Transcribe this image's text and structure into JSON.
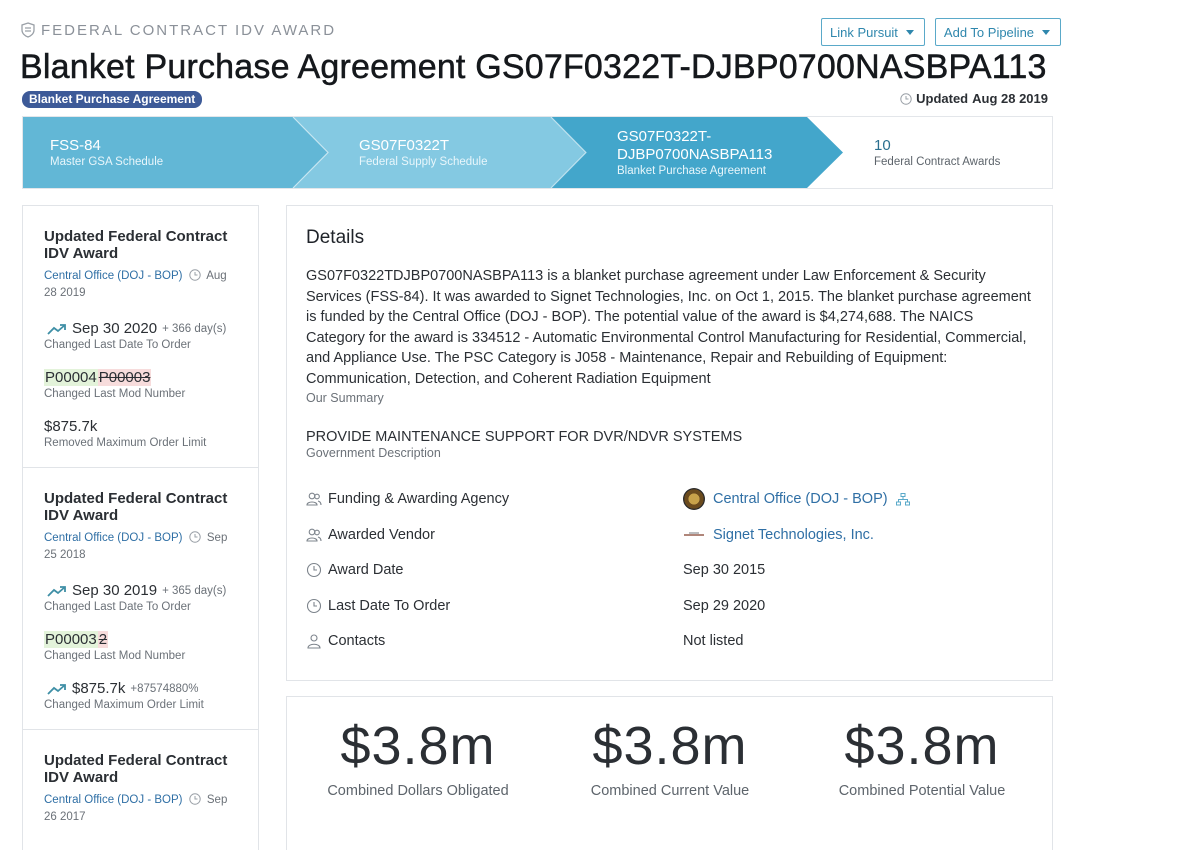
{
  "header": {
    "eyebrow": "FEDERAL CONTRACT IDV AWARD",
    "title": "Blanket Purchase Agreement GS07F0322T-DJBP0700NASBPA113",
    "type_badge": "Blanket Purchase Agreement",
    "updated_label": "Updated",
    "updated_date": "Aug 28 2019",
    "actions": [
      "Link Pursuit",
      "Add To Pipeline"
    ]
  },
  "breadcrumbs": [
    {
      "title": "FSS-84",
      "subtitle": "Master GSA Schedule"
    },
    {
      "title": "GS07F0322T",
      "subtitle": "Federal Supply Schedule"
    },
    {
      "title_line1": "GS07F0322T-",
      "title_line2": "DJBP0700NASBPA113",
      "subtitle": "Blanket Purchase Agreement"
    },
    {
      "title": "10",
      "subtitle": "Federal Contract Awards"
    }
  ],
  "timeline": [
    {
      "title": "Updated Federal Contract IDV Award",
      "agency": "Central Office (DOJ - BOP)",
      "date": "Aug 28 2019",
      "changes": [
        {
          "value": "Sep 30 2020",
          "delta": "+ 366 day(s)",
          "desc": "Changed Last Date To Order"
        },
        {
          "new": "P00004",
          "old": "P00003",
          "desc": "Changed Last Mod Number"
        },
        {
          "value": "$875.7k",
          "desc": "Removed Maximum Order Limit"
        }
      ]
    },
    {
      "title": "Updated Federal Contract IDV Award",
      "agency": "Central Office (DOJ - BOP)",
      "date": "Sep 25 2018",
      "changes": [
        {
          "value": "Sep 30 2019",
          "delta": "+ 365 day(s)",
          "desc": "Changed Last Date To Order"
        },
        {
          "new": "P00003",
          "old": "2",
          "desc": "Changed Last Mod Number"
        },
        {
          "value": "$875.7k",
          "delta": "+87574880%",
          "desc": "Changed Maximum Order Limit"
        }
      ]
    },
    {
      "title": "Updated Federal Contract IDV Award",
      "agency": "Central Office (DOJ - BOP)",
      "date": "Sep 26 2017"
    }
  ],
  "details": {
    "heading": "Details",
    "summary": "GS07F0322TDJBP0700NASBPA113 is a blanket purchase agreement under Law Enforcement & Security Services (FSS-84). It was awarded to Signet Technologies, Inc. on Oct 1, 2015. The blanket purchase agreement is funded by the Central Office (DOJ - BOP). The potential value of the award is $4,274,688. The NAICS Category for the award is 334512 - Automatic Environmental Control Manufacturing for Residential, Commercial, and Appliance Use. The PSC Category is J058 - Maintenance, Repair and Rebuilding of Equipment: Communication, Detection, and Coherent Radiation Equipment",
    "summary_label": "Our Summary",
    "gov_description": "PROVIDE MAINTENANCE SUPPORT FOR DVR/NDVR SYSTEMS",
    "gov_label": "Government Description",
    "rows": [
      {
        "label": "Funding & Awarding Agency",
        "value": "Central Office (DOJ - BOP)",
        "icon": "users-icon"
      },
      {
        "label": "Awarded Vendor",
        "value": "Signet Technologies, Inc.",
        "icon": "users-icon"
      },
      {
        "label": "Award Date",
        "value": "Sep 30 2015",
        "icon": "clock-icon"
      },
      {
        "label": "Last Date To Order",
        "value": "Sep 29 2020",
        "icon": "clock-icon"
      },
      {
        "label": "Contacts",
        "value": "Not listed",
        "icon": "user-icon"
      }
    ]
  },
  "values": [
    {
      "amount": "$3.8m",
      "label": "Combined Dollars Obligated"
    },
    {
      "amount": "$3.8m",
      "label": "Combined Current Value"
    },
    {
      "amount": "$3.8m",
      "label": "Combined Potential Value"
    }
  ],
  "colors": {
    "crumb_dark": "#43a6cb",
    "crumb_mid": "#62b7d6",
    "crumb_light": "#84c9e2",
    "link": "#2f6fa5",
    "badge": "#3d5a98"
  }
}
